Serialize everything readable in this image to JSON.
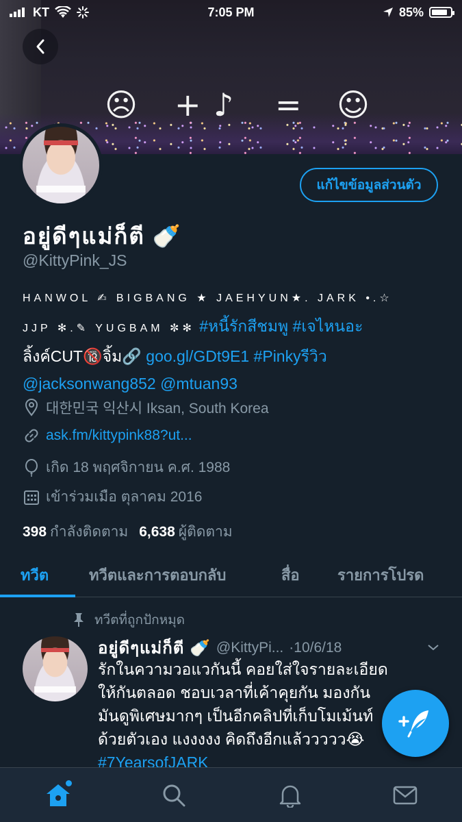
{
  "status_bar": {
    "carrier": "KT",
    "time": "7:05 PM",
    "battery_percent": "85%",
    "battery_level": 0.85
  },
  "banner": {
    "formula": [
      "☹",
      "+",
      "♪",
      "=",
      "☺"
    ]
  },
  "profile": {
    "edit_button": "แก้ไขข้อมูลส่วนตัว",
    "name": "อยู่ดีๆแม่ก็ตี 🍼",
    "handle": "@KittyPink_JS",
    "bio": {
      "line1": "HANWOL ✍ BIGBANG ★ JAEHYUN★. JARK •.☆",
      "line2_text": "JJP ✻.✎ YUGBAM ✼✻",
      "line2_tags": "#หนี้รักสีชมพู #เจไหนอะ",
      "line3_text": "ลิ้งค์CUT🔞จิ้ม🔗",
      "line3_links": "goo.gl/GDt9E1 #Pinkyรีวิว",
      "line4_links": "@jacksonwang852 @mtuan93"
    },
    "location": "대한민국 익산시 Iksan, South Korea",
    "website": "ask.fm/kittypink88?ut...",
    "birthday": "เกิด 18 พฤศจิกายน ค.ศ. 1988",
    "joined": "เข้าร่วมเมือ ตุลาคม 2016",
    "following_count": "398",
    "following_label": "กำลังติดตาม",
    "followers_count": "6,638",
    "followers_label": "ผู้ติดตาม"
  },
  "tabs": [
    {
      "label": "ทวีต",
      "active": true
    },
    {
      "label": "ทวีตและการตอบกลับ",
      "active": false
    },
    {
      "label": "สื่อ",
      "active": false
    },
    {
      "label": "รายการโปรด",
      "active": false
    }
  ],
  "tweet": {
    "pinned_label": "ทวีตที่ถูกปักหมุด",
    "name": "อยู่ดีๆแม่ก็ตี 🍼",
    "handle": "@KittyPi...",
    "date": "·10/6/18",
    "lines": [
      "รักในความวอแวกันนี้ คอยใส่ใจรายละเอียด",
      "ให้กันตลอด ชอบเวลาที่เค้าคุยกัน มองกัน",
      "มันดูพิเศษมากๆ เป็นอีกคลิปที่เก็บโมเม้นท์",
      "ด้วยตัวเอง แงงงงง คิดถึงอีกแล้ววววว😭"
    ],
    "hashtag": "#7YearsofJARK"
  },
  "colors": {
    "background": "#15202b",
    "accent": "#1da1f2",
    "muted": "#8899a6",
    "nav_bg": "#1c2938"
  }
}
